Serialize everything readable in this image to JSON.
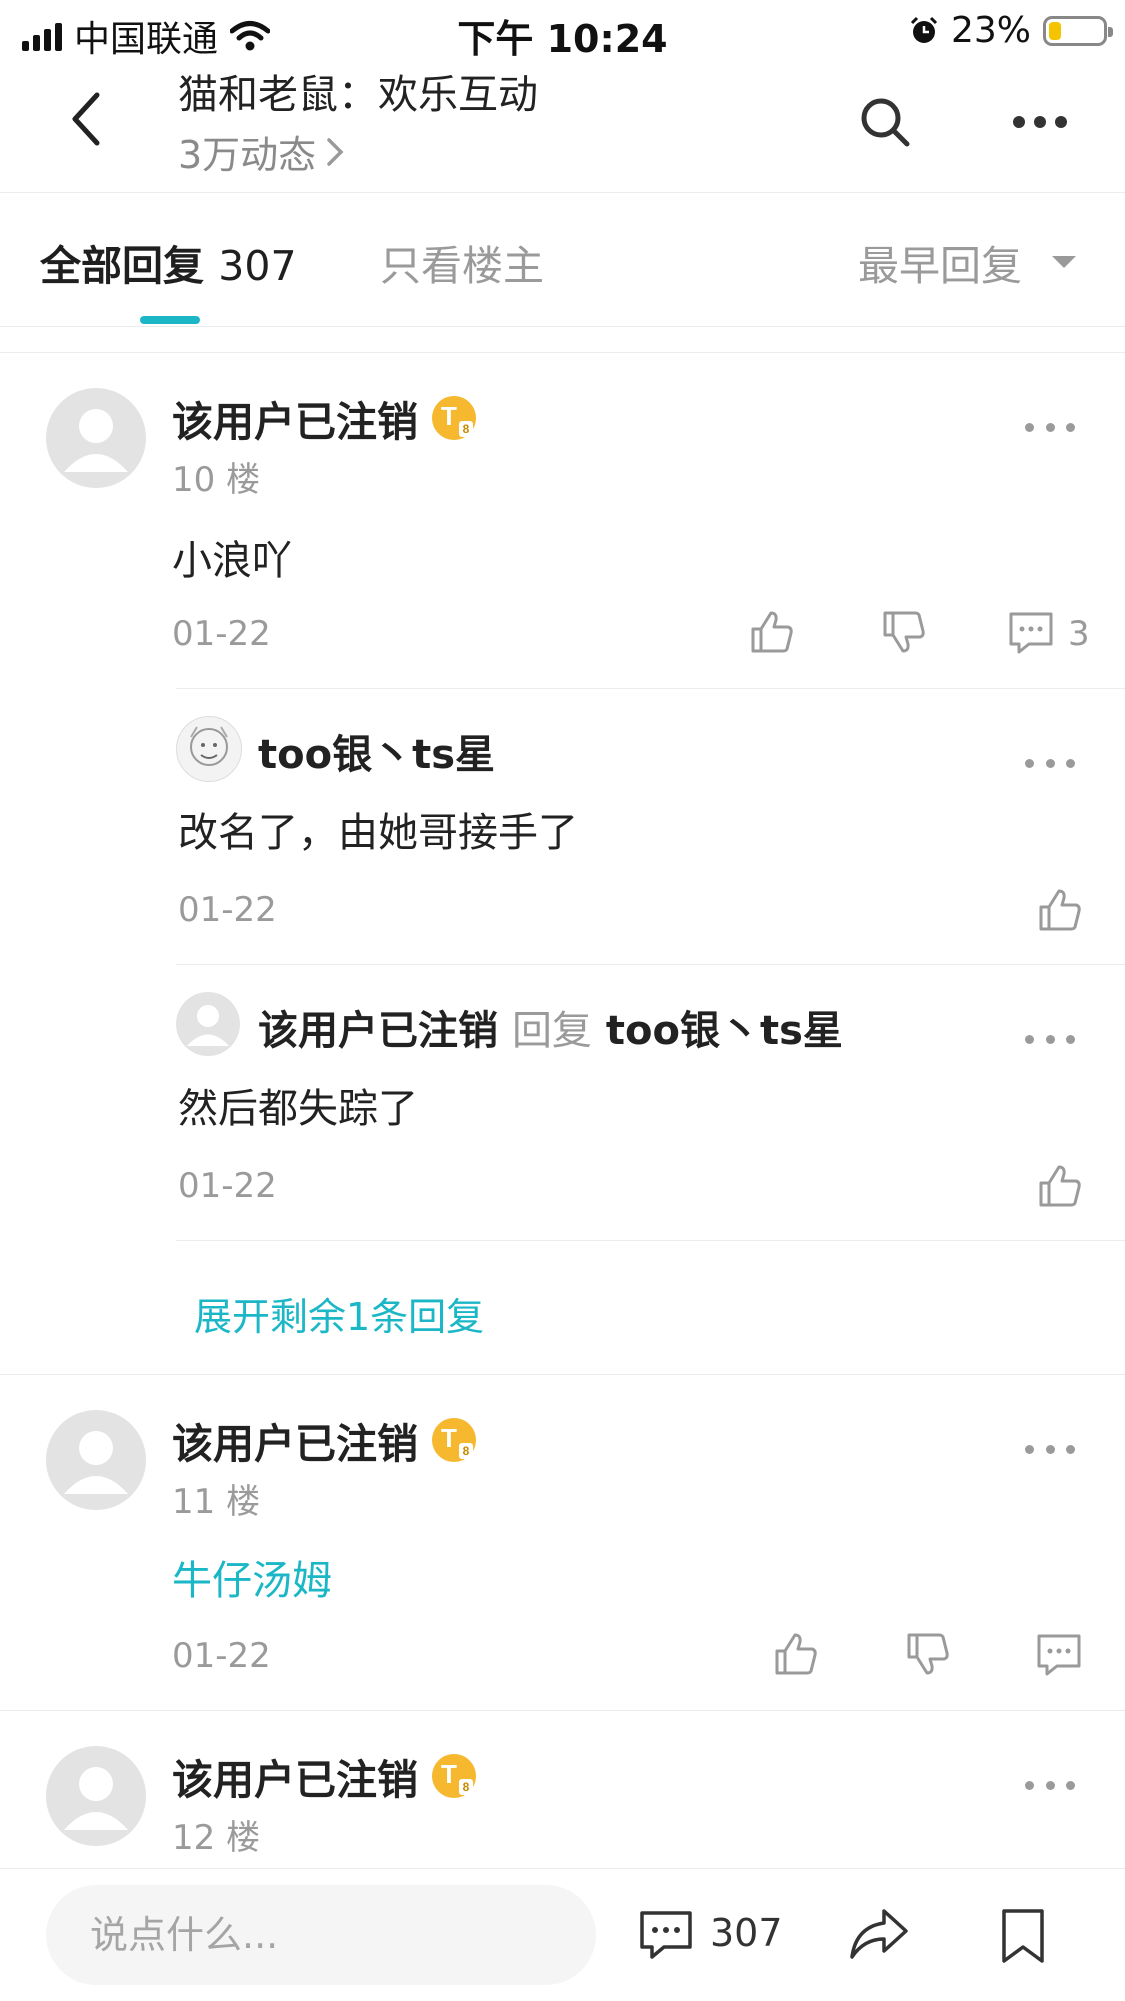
{
  "status_bar": {
    "carrier": "中国联通",
    "time": "下午 10:24",
    "battery": "23%",
    "battery_level": 0.23
  },
  "header": {
    "title": "猫和老鼠：欢乐互动",
    "subtitle": "3万动态",
    "icons": [
      "back-icon",
      "search-icon",
      "more-icon"
    ]
  },
  "tabs": {
    "all_label": "全部回复",
    "all_count": "307",
    "owner_label": "只看楼主",
    "sort_label": "最早回复"
  },
  "posts": [
    {
      "username": "该用户已注销",
      "floor": "10 楼",
      "content": "小浪吖",
      "date": "01-22",
      "reply_count": "3",
      "replies": [
        {
          "username": "too银丶ts星",
          "content": "改名了，由她哥接手了",
          "date": "01-22"
        },
        {
          "username": "该用户已注销",
          "reply_word": "回复",
          "reply_to": "too银丶ts星",
          "content": "然后都失踪了",
          "date": "01-22"
        }
      ],
      "expand_label": "展开剩余1条回复"
    },
    {
      "username": "该用户已注销",
      "floor": "11 楼",
      "content": "牛仔汤姆",
      "date": "01-22"
    },
    {
      "username": "该用户已注销",
      "floor": "12 楼"
    }
  ],
  "bottom_bar": {
    "placeholder": "说点什么...",
    "comment_count": "307"
  },
  "colors": {
    "accent": "#1bb7c6",
    "badge": "#f5b82e",
    "muted": "#9a9a9a"
  }
}
